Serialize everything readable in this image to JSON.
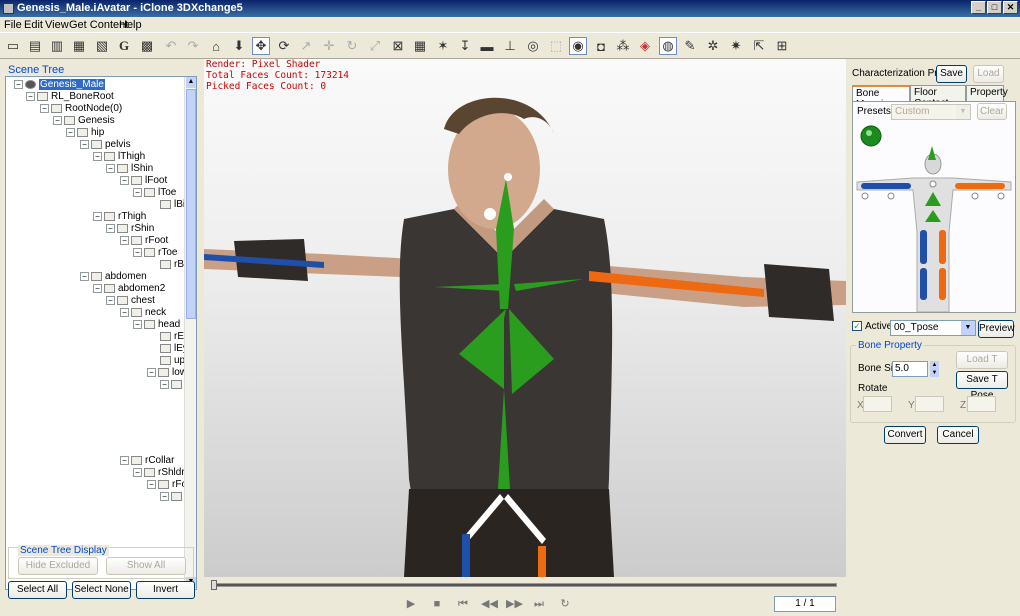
{
  "window": {
    "title": "Genesis_Male.iAvatar - iClone 3DXchange5",
    "controls": [
      "_",
      "□",
      "✕"
    ]
  },
  "menu": [
    "File",
    "Edit",
    "View",
    "Get Content",
    "Help"
  ],
  "toolbar": {
    "icons": [
      "open-icon",
      "save-icon",
      "import-icon",
      "export-icon",
      "export2-icon",
      "g-icon",
      "convert-icon",
      "undo-icon",
      "redo-icon",
      "home-icon",
      "download-icon",
      "move-icon",
      "rotate-icon",
      "pick-icon",
      "translate-icon",
      "rotate2-icon",
      "scale-icon",
      "wire-icon",
      "grid-icon",
      "pose-icon",
      "pin-icon",
      "box-icon",
      "bone-icon",
      "sphere-icon",
      "select-icon",
      "light-icon",
      "camera-icon",
      "nodes-icon",
      "paint-icon",
      "globe-icon",
      "wrench-icon",
      "gear-icon",
      "gear2-icon",
      "export3-icon",
      "cart-icon"
    ],
    "g_label": "G"
  },
  "scene_tree": {
    "caption": "Scene Tree",
    "nodes": [
      {
        "label": "Genesis_Male",
        "expander": "−"
      },
      {
        "label": "RL_BoneRoot",
        "expander": "−"
      },
      {
        "label": "RootNode(0)",
        "expander": "−"
      },
      {
        "label": "Genesis",
        "expander": "−"
      },
      {
        "label": "hip",
        "expander": "−"
      },
      {
        "label": "pelvis",
        "expander": "−"
      },
      {
        "label": "lThigh",
        "expander": "−"
      },
      {
        "label": "lShin",
        "expander": "−"
      },
      {
        "label": "lFoot",
        "expander": "−"
      },
      {
        "label": "lToe",
        "expander": "−"
      },
      {
        "label": "lBig",
        "expander": ""
      },
      {
        "label": "rThigh",
        "expander": "−"
      },
      {
        "label": "rShin",
        "expander": "−"
      },
      {
        "label": "rFoot",
        "expander": "−"
      },
      {
        "label": "rToe",
        "expander": "−"
      },
      {
        "label": "rBi",
        "expander": ""
      },
      {
        "label": "abdomen",
        "expander": "−"
      },
      {
        "label": "abdomen2",
        "expander": "−"
      },
      {
        "label": "chest",
        "expander": "−"
      },
      {
        "label": "neck",
        "expander": "−"
      },
      {
        "label": "head",
        "expander": "−"
      },
      {
        "label": "rEy",
        "expander": ""
      },
      {
        "label": "lEy",
        "expander": ""
      },
      {
        "label": "upp",
        "expander": ""
      },
      {
        "label": "low",
        "expander": "−"
      },
      {
        "label": "",
        "expander": "−"
      },
      {
        "label": "rCollar",
        "expander": "−"
      },
      {
        "label": "rShldr",
        "expander": "−"
      },
      {
        "label": "rFo",
        "expander": "−"
      },
      {
        "label": "",
        "expander": "−"
      }
    ]
  },
  "scene_display": {
    "caption": "Scene Tree Display",
    "hide_excluded": "Hide Excluded",
    "show_all": "Show All"
  },
  "bottom_buttons": {
    "select_all": "Select All",
    "select_none": "Select None",
    "invert": "Invert"
  },
  "viewport": {
    "render": "Render: Pixel Shader",
    "total_faces": "Total Faces Count: 173214",
    "picked_faces": "Picked Faces Count: 0"
  },
  "timeline": {
    "frame": "1 / 1",
    "progress": 0
  },
  "characterization": {
    "label": "Characterization Profile",
    "save": "Save",
    "load": "Load",
    "tabs": [
      "Bone Mapping",
      "Floor Contact",
      "Property"
    ],
    "presets_label": "Presets:",
    "presets_value": "Custom",
    "clear": "Clear",
    "active_label": "Active",
    "active_checked": true,
    "pose_value": "00_Tpose",
    "preview": "Preview"
  },
  "bone_property": {
    "caption": "Bone Property",
    "load_tpose": "Load T Pose",
    "save_tpose": "Save T Pose",
    "bone_size_label": "Bone Size",
    "bone_size": "5.0",
    "rotate_label": "Rotate",
    "x_label": "X",
    "y_label": "Y",
    "z_label": "Z"
  },
  "actions": {
    "convert": "Convert",
    "cancel": "Cancel"
  },
  "colors": {
    "bone_green": "#2a9d1f",
    "bone_blue": "#1f4fa8",
    "bone_orange": "#ee6a12",
    "overlay_text": "#d00000",
    "selection": "#316ac5"
  }
}
